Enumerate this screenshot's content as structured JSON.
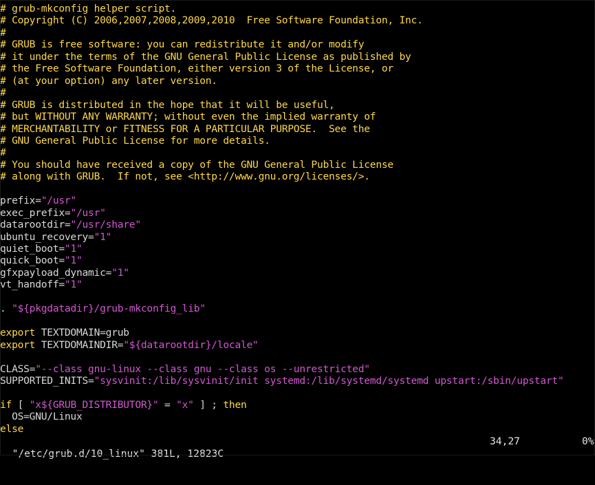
{
  "lines": [
    {
      "segments": [
        {
          "t": "# grub-mkconfig helper script.",
          "k": "c"
        }
      ]
    },
    {
      "segments": [
        {
          "t": "# Copyright (C) 2006,2007,2008,2009,2010  Free Software Foundation, Inc.",
          "k": "c"
        }
      ]
    },
    {
      "segments": [
        {
          "t": "#",
          "k": "c"
        }
      ]
    },
    {
      "segments": [
        {
          "t": "# GRUB is free software: you can redistribute it and/or modify",
          "k": "c"
        }
      ]
    },
    {
      "segments": [
        {
          "t": "# it under the terms of the GNU General Public License as published by",
          "k": "c"
        }
      ]
    },
    {
      "segments": [
        {
          "t": "# the Free Software Foundation, either version 3 of the License, or",
          "k": "c"
        }
      ]
    },
    {
      "segments": [
        {
          "t": "# (at your option) any later version.",
          "k": "c"
        }
      ]
    },
    {
      "segments": [
        {
          "t": "#",
          "k": "c"
        }
      ]
    },
    {
      "segments": [
        {
          "t": "# GRUB is distributed in the hope that it will be useful,",
          "k": "c"
        }
      ]
    },
    {
      "segments": [
        {
          "t": "# but WITHOUT ANY WARRANTY; without even the implied warranty of",
          "k": "c"
        }
      ]
    },
    {
      "segments": [
        {
          "t": "# MERCHANTABILITY or FITNESS FOR A PARTICULAR PURPOSE.  See the",
          "k": "c"
        }
      ]
    },
    {
      "segments": [
        {
          "t": "# GNU General Public License for more details.",
          "k": "c"
        }
      ]
    },
    {
      "segments": [
        {
          "t": "#",
          "k": "c"
        }
      ]
    },
    {
      "segments": [
        {
          "t": "# You should have received a copy of the GNU General Public License",
          "k": "c"
        }
      ]
    },
    {
      "segments": [
        {
          "t": "# along with GRUB.  If not, see <http://www.gnu.org/licenses/>.",
          "k": "c"
        }
      ]
    },
    {
      "segments": []
    },
    {
      "segments": [
        {
          "t": "prefix=",
          "k": "txt"
        },
        {
          "t": "\"/usr\"",
          "k": "str"
        }
      ]
    },
    {
      "segments": [
        {
          "t": "exec_prefix=",
          "k": "txt"
        },
        {
          "t": "\"/usr\"",
          "k": "str"
        }
      ]
    },
    {
      "segments": [
        {
          "t": "datarootdir=",
          "k": "txt"
        },
        {
          "t": "\"/usr/share\"",
          "k": "str"
        }
      ]
    },
    {
      "segments": [
        {
          "t": "ubuntu_recovery=",
          "k": "txt"
        },
        {
          "t": "\"1\"",
          "k": "str"
        }
      ]
    },
    {
      "segments": [
        {
          "t": "quiet_boot=",
          "k": "txt"
        },
        {
          "t": "\"1\"",
          "k": "str"
        }
      ]
    },
    {
      "segments": [
        {
          "t": "quick_boot=",
          "k": "txt"
        },
        {
          "t": "\"1\"",
          "k": "str"
        }
      ]
    },
    {
      "segments": [
        {
          "t": "gfxpayload_dynamic=",
          "k": "txt"
        },
        {
          "t": "\"1\"",
          "k": "str"
        }
      ]
    },
    {
      "segments": [
        {
          "t": "vt_handoff=",
          "k": "txt"
        },
        {
          "t": "\"1\"",
          "k": "str"
        }
      ]
    },
    {
      "segments": []
    },
    {
      "segments": [
        {
          "t": ". ",
          "k": "txt"
        },
        {
          "t": "\"${pkgdatadir}/grub-mkconfig_lib\"",
          "k": "str"
        }
      ]
    },
    {
      "segments": []
    },
    {
      "segments": [
        {
          "t": "export",
          "k": "kw"
        },
        {
          "t": " TEXTDOMAIN=grub",
          "k": "txt"
        }
      ]
    },
    {
      "segments": [
        {
          "t": "export",
          "k": "kw"
        },
        {
          "t": " TEXTDOMAINDIR=",
          "k": "txt"
        },
        {
          "t": "\"${datarootdir}/locale\"",
          "k": "str"
        }
      ]
    },
    {
      "segments": []
    },
    {
      "segments": [
        {
          "t": "CLASS=",
          "k": "txt"
        },
        {
          "t": "\"--class gnu-linux --class gnu --class os --unrestricted\"",
          "k": "str"
        }
      ]
    },
    {
      "segments": [
        {
          "t": "SUPPORTED_INITS=",
          "k": "txt"
        },
        {
          "t": "\"sysvinit:/lib/sysvinit/init systemd:/lib/systemd/systemd upstart:/sbin/upstart\"",
          "k": "str"
        }
      ]
    },
    {
      "segments": []
    },
    {
      "segments": [
        {
          "t": "if",
          "k": "kw"
        },
        {
          "t": " [ ",
          "k": "txt"
        },
        {
          "t": "\"x${GRUB_DISTRIBUTOR}\"",
          "k": "str"
        },
        {
          "t": " = ",
          "k": "txt"
        },
        {
          "t": "\"x\"",
          "k": "str"
        },
        {
          "t": " ] ; ",
          "k": "txt"
        },
        {
          "t": "then",
          "k": "kw"
        }
      ]
    },
    {
      "segments": [
        {
          "t": "  OS=GNU/Linux",
          "k": "txt"
        }
      ]
    },
    {
      "segments": [
        {
          "t": "else",
          "k": "kw"
        }
      ]
    }
  ],
  "status": {
    "file": "\"/etc/grub.d/10_linux\" 381L, 12823C",
    "position": "34,27",
    "percent": "0%"
  },
  "colors": {
    "background": "#000000",
    "comment": "#ffd84a",
    "string": "#d257d2",
    "text": "#d9d9d9"
  }
}
